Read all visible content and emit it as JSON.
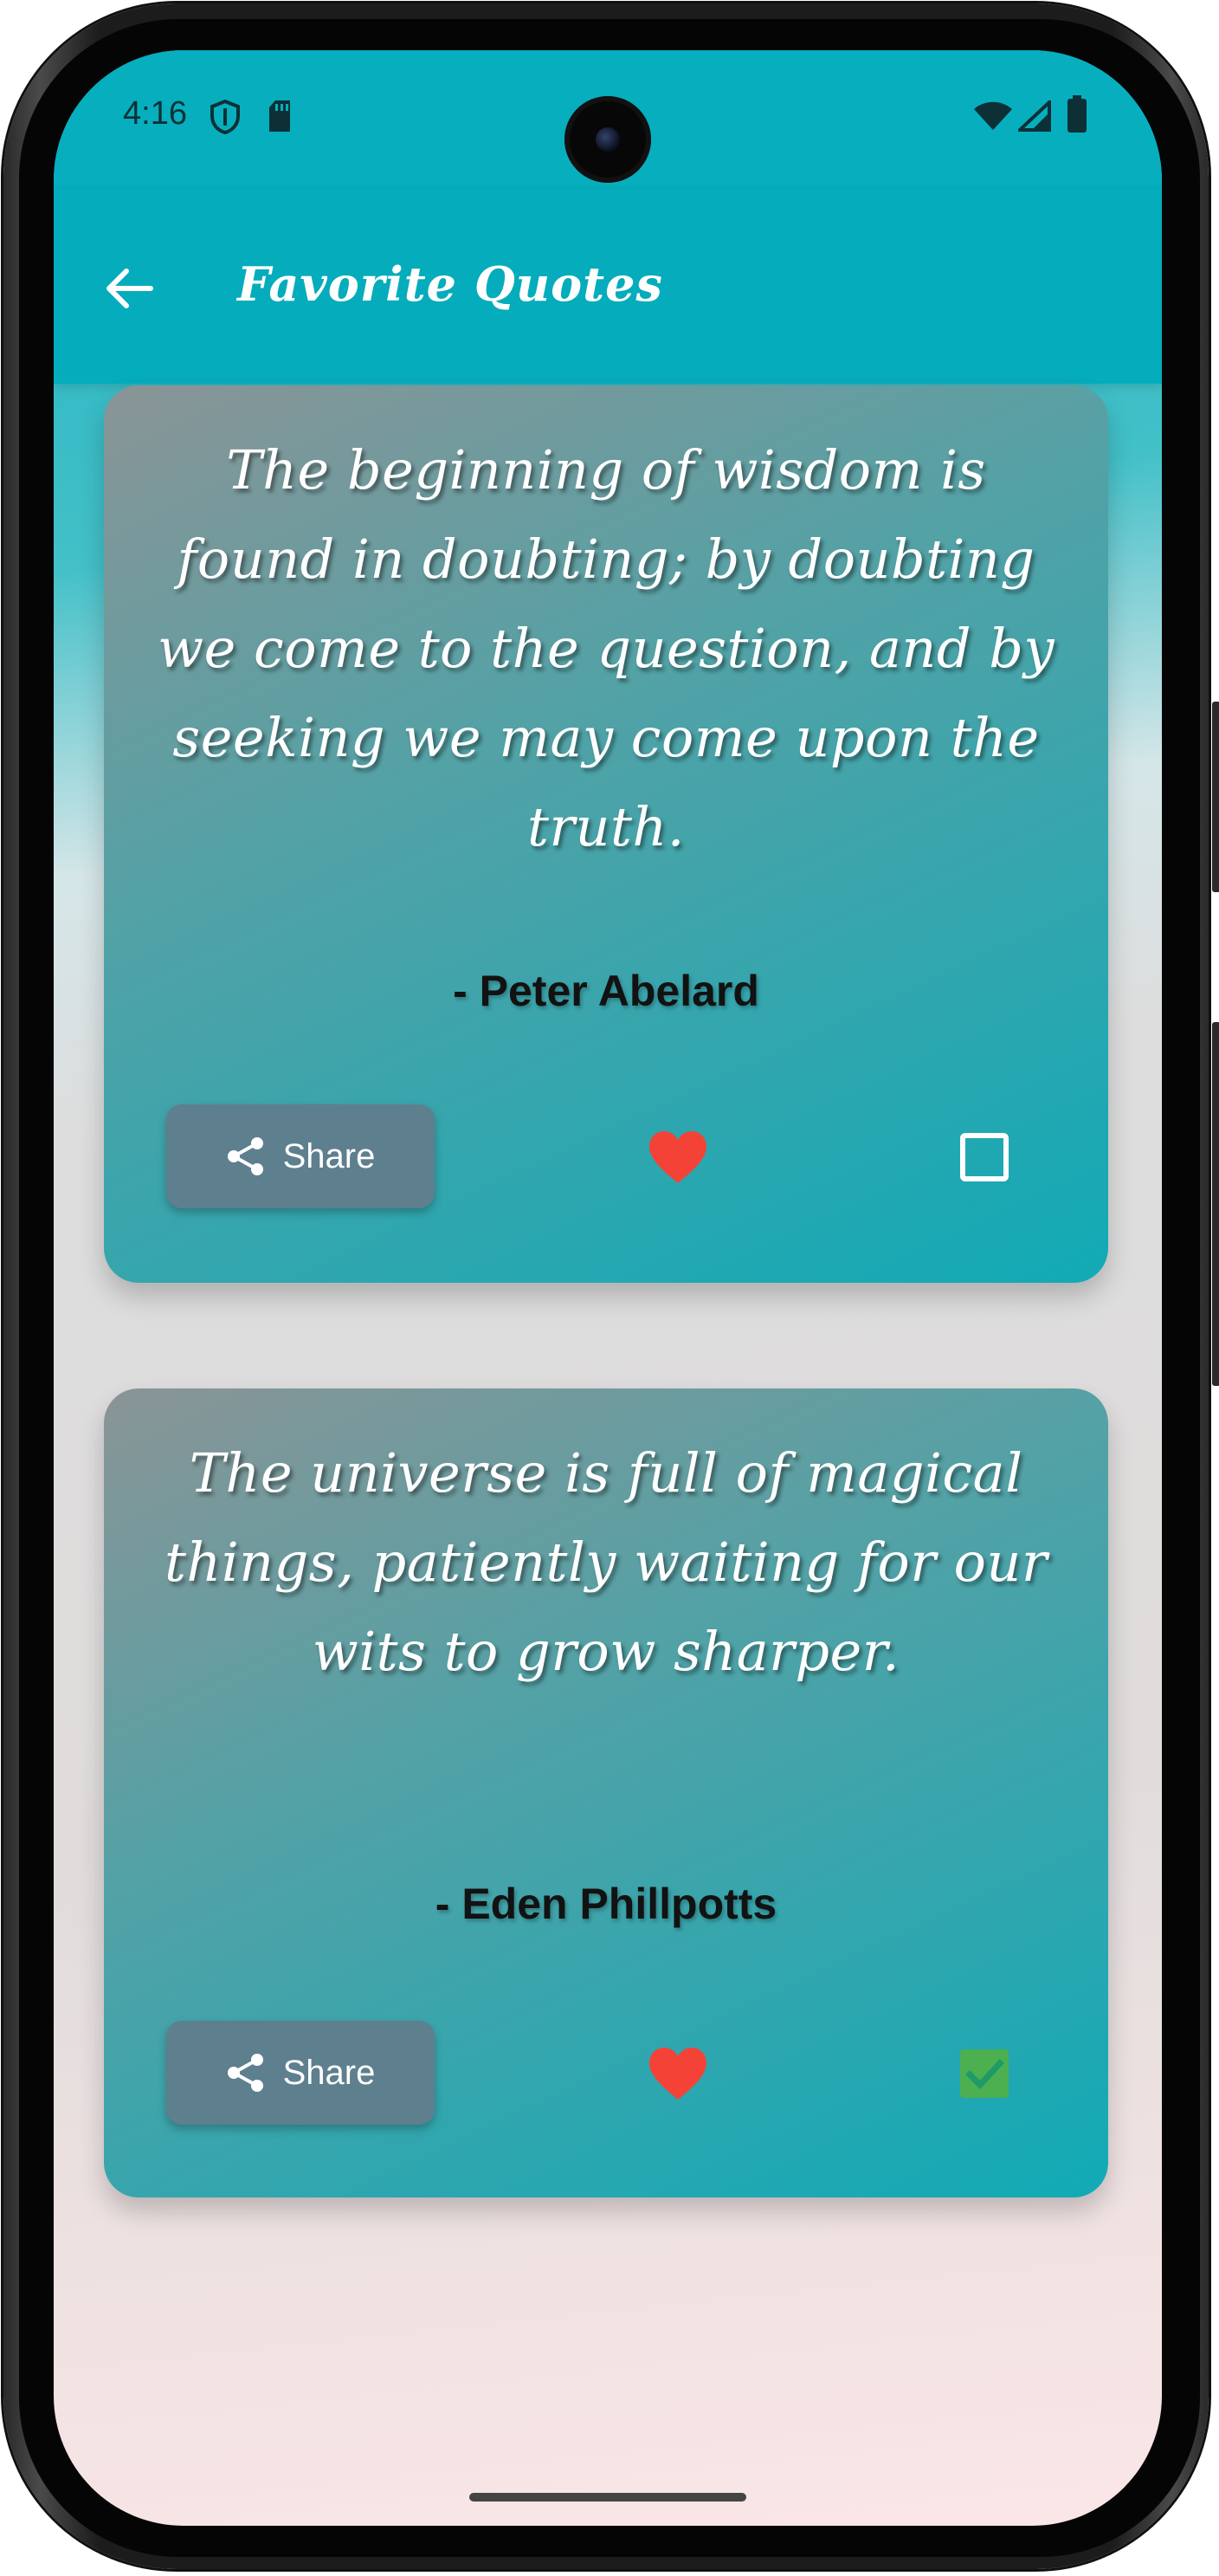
{
  "status_bar": {
    "time": "4:16",
    "icons": [
      "shield-icon",
      "sd-card-icon",
      "wifi-icon",
      "signal-icon",
      "battery-icon"
    ]
  },
  "app_bar": {
    "back_icon": "arrow-left-icon",
    "title": "Favorite Quotes"
  },
  "quotes": [
    {
      "text": "The beginning of wisdom is found in doubting; by doubting we come to the question, and by seeking we may come upon the truth.",
      "author": "- Peter Abelard",
      "share_label": "Share",
      "favorited": true,
      "selected": false
    },
    {
      "text": "The universe is full of magical things, patiently waiting for our wits to grow sharper.",
      "author": "- Eden Phillpotts",
      "share_label": "Share",
      "favorited": true,
      "selected": true
    }
  ],
  "colors": {
    "app_bar": "#05acbc",
    "heart": "#f44336",
    "checked": "#4caf50",
    "share_button": "#5e7f8e"
  }
}
